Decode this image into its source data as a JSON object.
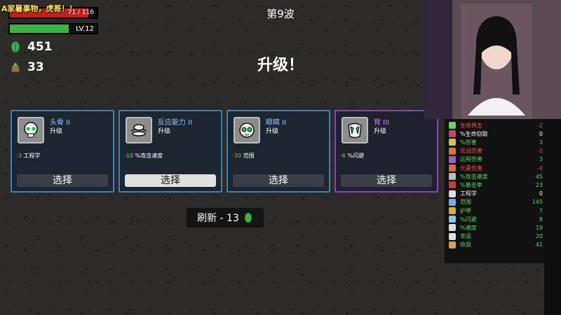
{
  "hud": {
    "streamer_note": "A家暑事物，虎哥！！",
    "hp_text": "71 / 116",
    "hp_fraction": 0.9,
    "level_text": "LV.12",
    "xp_fraction": 0.68,
    "materials": "451",
    "bag_count": "33"
  },
  "wave": {
    "title": "第9波"
  },
  "level_up": {
    "title": "升级！"
  },
  "cards": [
    {
      "name": "头骨 II",
      "sub": "升级",
      "effect_num": "-3",
      "effect_text": " 工程学",
      "button": "选择",
      "icon": "skull-icon",
      "rarity": "rare-blue",
      "active": false
    },
    {
      "name": "反应能力 II",
      "sub": "升级",
      "effect_num": "-10",
      "effect_text": " %攻击速度",
      "button": "选择",
      "icon": "reflex-icon",
      "rarity": "rare-blue",
      "active": true
    },
    {
      "name": "眼睛 II",
      "sub": "升级",
      "effect_num": "-30",
      "effect_text": " 范围",
      "button": "选择",
      "icon": "eyes-icon",
      "rarity": "rare-blue",
      "active": false
    },
    {
      "name": "背 III",
      "sub": "升级",
      "effect_num": "-6",
      "effect_text": " %闪避",
      "button": "选择",
      "icon": "back-icon",
      "rarity": "epic-purple",
      "active": false
    }
  ],
  "refresh": {
    "label": "刷新 - 13"
  },
  "stats": [
    {
      "label": "生命再生",
      "value": "-2",
      "color": "red"
    },
    {
      "label": "%生命窃取",
      "value": "0",
      "color": "white"
    },
    {
      "label": "%伤害",
      "value": "3",
      "color": "green"
    },
    {
      "label": "近战伤害",
      "value": "-2",
      "color": "red"
    },
    {
      "label": "远程伤害",
      "value": "3",
      "color": "green"
    },
    {
      "label": "元素伤害",
      "value": "-4",
      "color": "red"
    },
    {
      "label": "%攻击速度",
      "value": "45",
      "color": "green"
    },
    {
      "label": "%暴击率",
      "value": "23",
      "color": "green"
    },
    {
      "label": "工程学",
      "value": "0",
      "color": "white"
    },
    {
      "label": "范围",
      "value": "145",
      "color": "green"
    },
    {
      "label": "护甲",
      "value": "7",
      "color": "green"
    },
    {
      "label": "%闪避",
      "value": "8",
      "color": "green"
    },
    {
      "label": "%速度",
      "value": "19",
      "color": "green"
    },
    {
      "label": "幸运",
      "value": "20",
      "color": "green"
    },
    {
      "label": "收获",
      "value": "41",
      "color": "green"
    }
  ],
  "colors": {
    "hp": "#c0201f",
    "xp": "#3fb33f",
    "card_border_blue": "#3e7fb8",
    "card_border_purple": "#8a3fc9"
  }
}
